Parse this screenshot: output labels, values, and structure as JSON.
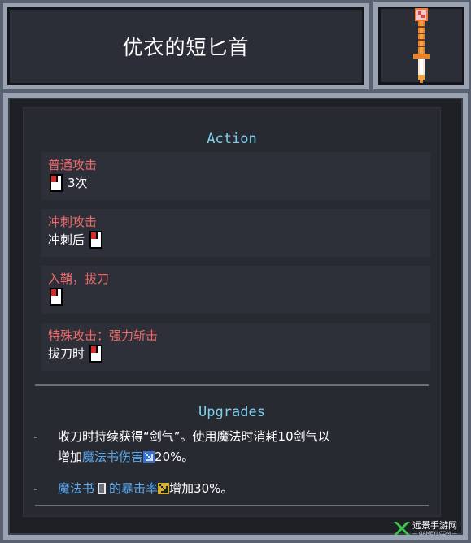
{
  "item": {
    "title": "优衣的短匕首",
    "icon": "dagger-icon"
  },
  "action": {
    "header": "Action",
    "entries": [
      {
        "name": "普通攻击",
        "pre": "",
        "post": "3次",
        "icon": "mouse-left-icon"
      },
      {
        "name": "冲刺攻击",
        "pre": "冲刺后",
        "post": "",
        "icon": "mouse-left-icon"
      },
      {
        "name": "入鞘，拔刀",
        "pre": "",
        "post": "",
        "icon": "mouse-left-icon"
      },
      {
        "name": "特殊攻击：强力斩击",
        "pre": "拔刀时",
        "post": "",
        "icon": "mouse-left-icon"
      }
    ]
  },
  "upgrades": {
    "header": "Upgrades",
    "items": [
      {
        "bullet": "-",
        "text1": "收刀时持续获得“剑气”。使用魔法时消耗10剑气以",
        "text2": "增加",
        "blue": "魔法书伤害",
        "suffix": "20%。"
      },
      {
        "bullet": "-",
        "blue": "魔法书",
        "blue2": "的暴击率",
        "suffix": "增加30%。"
      }
    ]
  },
  "watermark": {
    "text": "远景手游网",
    "sub": "— GAMEYJ.COM —"
  },
  "colors": {
    "title_text": "#ffffff",
    "section_header": "#7fd0ec",
    "entry_name": "#f06a6a",
    "highlight": "#5aa8f0"
  }
}
